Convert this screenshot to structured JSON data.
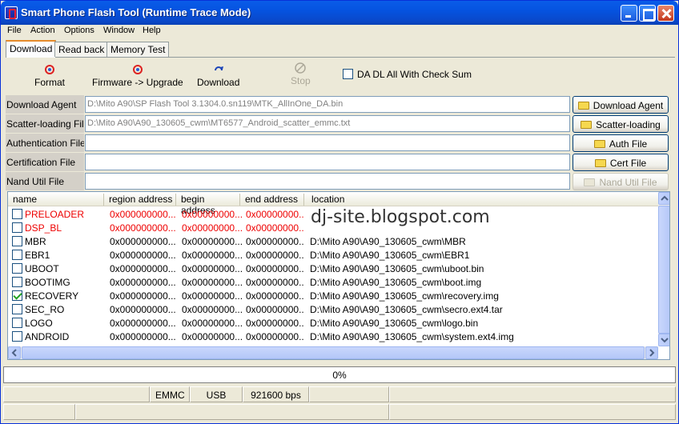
{
  "window": {
    "title": "Smart Phone Flash Tool (Runtime Trace Mode)"
  },
  "menu": [
    "File",
    "Action",
    "Options",
    "Window",
    "Help"
  ],
  "tabs": [
    "Download",
    "Read back",
    "Memory Test"
  ],
  "toolbar": {
    "format": "Format",
    "firmware_upgrade": "Firmware -> Upgrade",
    "download": "Download",
    "stop": "Stop",
    "checksum_label": "DA DL All With Check Sum"
  },
  "fields": [
    {
      "label": "Download Agent",
      "value": "D:\\Mito A90\\SP Flash Tool 3.1304.0.sn119\\MTK_AllInOne_DA.bin",
      "button": "Download Agent"
    },
    {
      "label": "Scatter-loading File",
      "value": "D:\\Mito A90\\A90_130605_cwm\\MT6577_Android_scatter_emmc.txt",
      "button": "Scatter-loading"
    },
    {
      "label": "Authentication File",
      "value": "",
      "button": "Auth File"
    },
    {
      "label": "Certification File",
      "value": "",
      "button": "Cert File"
    },
    {
      "label": "Nand Util File",
      "value": "",
      "button": "Nand Util File"
    }
  ],
  "table": {
    "columns": [
      "name",
      "region address",
      "begin address",
      "end address",
      "location"
    ],
    "rows": [
      {
        "name": "PRELOADER",
        "region": "0x000000000...",
        "begin": "0x00000000...",
        "end": "0x00000000...",
        "location": "",
        "checked": false,
        "red": true
      },
      {
        "name": "DSP_BL",
        "region": "0x000000000...",
        "begin": "0x00000000...",
        "end": "0x00000000...",
        "location": "",
        "checked": false,
        "red": true
      },
      {
        "name": "MBR",
        "region": "0x000000000...",
        "begin": "0x00000000...",
        "end": "0x00000000...",
        "location": "D:\\Mito A90\\A90_130605_cwm\\MBR",
        "checked": false,
        "red": false
      },
      {
        "name": "EBR1",
        "region": "0x000000000...",
        "begin": "0x00000000...",
        "end": "0x00000000...",
        "location": "D:\\Mito A90\\A90_130605_cwm\\EBR1",
        "checked": false,
        "red": false
      },
      {
        "name": "UBOOT",
        "region": "0x000000000...",
        "begin": "0x00000000...",
        "end": "0x00000000...",
        "location": "D:\\Mito A90\\A90_130605_cwm\\uboot.bin",
        "checked": false,
        "red": false
      },
      {
        "name": "BOOTIMG",
        "region": "0x000000000...",
        "begin": "0x00000000...",
        "end": "0x00000000...",
        "location": "D:\\Mito A90\\A90_130605_cwm\\boot.img",
        "checked": false,
        "red": false
      },
      {
        "name": "RECOVERY",
        "region": "0x000000000...",
        "begin": "0x00000000...",
        "end": "0x00000000...",
        "location": "D:\\Mito A90\\A90_130605_cwm\\recovery.img",
        "checked": true,
        "red": false
      },
      {
        "name": "SEC_RO",
        "region": "0x000000000...",
        "begin": "0x00000000...",
        "end": "0x00000000...",
        "location": "D:\\Mito A90\\A90_130605_cwm\\secro.ext4.tar",
        "checked": false,
        "red": false
      },
      {
        "name": "LOGO",
        "region": "0x000000000...",
        "begin": "0x00000000...",
        "end": "0x00000000...",
        "location": "D:\\Mito A90\\A90_130605_cwm\\logo.bin",
        "checked": false,
        "red": false
      },
      {
        "name": "ANDROID",
        "region": "0x000000000...",
        "begin": "0x00000000...",
        "end": "0x00000000...",
        "location": "D:\\Mito A90\\A90_130605_cwm\\system.ext4.img",
        "checked": false,
        "red": false
      }
    ]
  },
  "watermark": "dj-site.blogspot.com",
  "progress": {
    "text": "0%",
    "fraction": 0
  },
  "status": [
    "EMMC",
    "USB",
    "921600 bps"
  ],
  "colors": {
    "title_bar": "#0a5ce8",
    "error_row": "#e00000",
    "tab_accent": "#e68b2c"
  }
}
